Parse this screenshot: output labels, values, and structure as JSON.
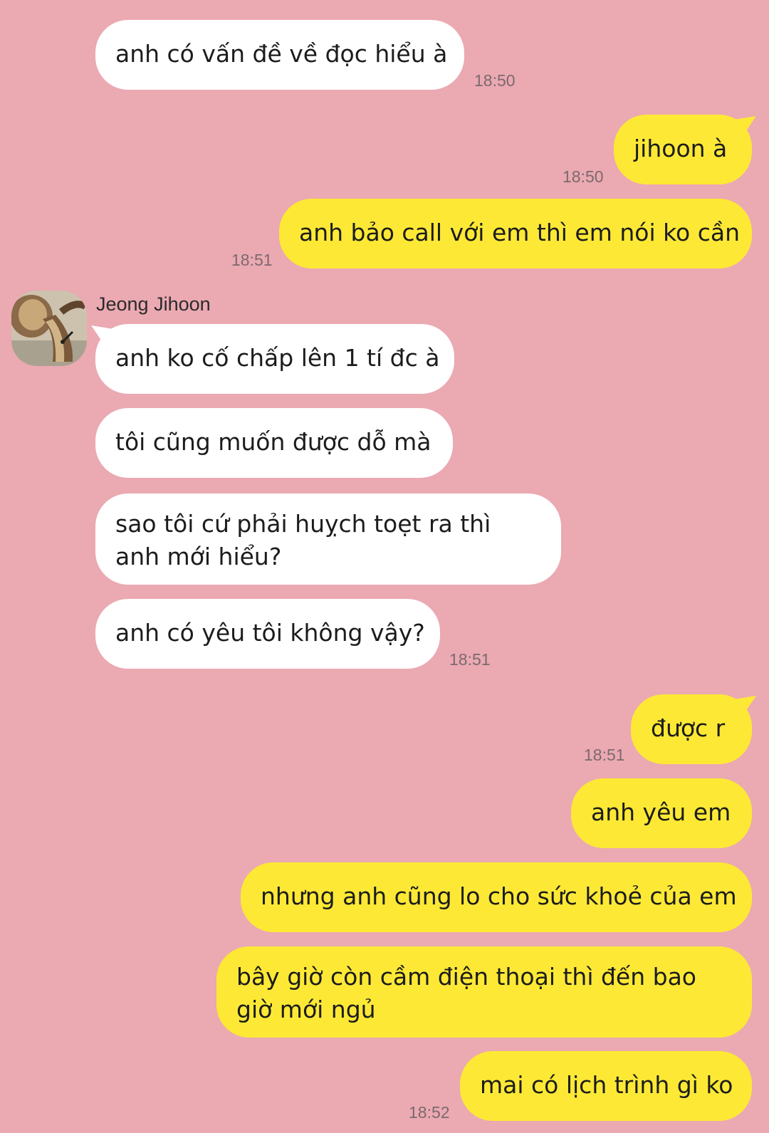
{
  "contact": {
    "name": "Jeong Jihoon",
    "avatar_icon": "cobra-avatar-icon"
  },
  "colors": {
    "background": "#eba9b2",
    "incoming_bubble": "#ffffff",
    "outgoing_bubble": "#fde935"
  },
  "messages": [
    {
      "direction": "in",
      "text": "anh có vấn đề về đọc hiểu à",
      "time": "18:50"
    },
    {
      "direction": "out",
      "text": "jihoon à",
      "time": "18:50"
    },
    {
      "direction": "out",
      "text": "anh bảo call với em thì em nói ko cần",
      "time": "18:51"
    },
    {
      "direction": "in",
      "text": "anh ko cố chấp lên 1 tí đc à",
      "time": ""
    },
    {
      "direction": "in",
      "text": "tôi cũng muốn được dỗ mà",
      "time": ""
    },
    {
      "direction": "in",
      "text": "sao tôi cứ phải huỵch toẹt ra thì anh mới hiểu?",
      "time": ""
    },
    {
      "direction": "in",
      "text": "anh có yêu tôi không vậy?",
      "time": "18:51"
    },
    {
      "direction": "out",
      "text": "được r",
      "time": "18:51"
    },
    {
      "direction": "out",
      "text": "anh yêu em",
      "time": ""
    },
    {
      "direction": "out",
      "text": "nhưng anh cũng lo cho sức khoẻ của em",
      "time": ""
    },
    {
      "direction": "out",
      "text": "bây giờ còn cầm điện thoại thì đến bao giờ mới ngủ",
      "time": ""
    },
    {
      "direction": "out",
      "text": "mai có lịch trình gì ko",
      "time": "18:52"
    }
  ]
}
